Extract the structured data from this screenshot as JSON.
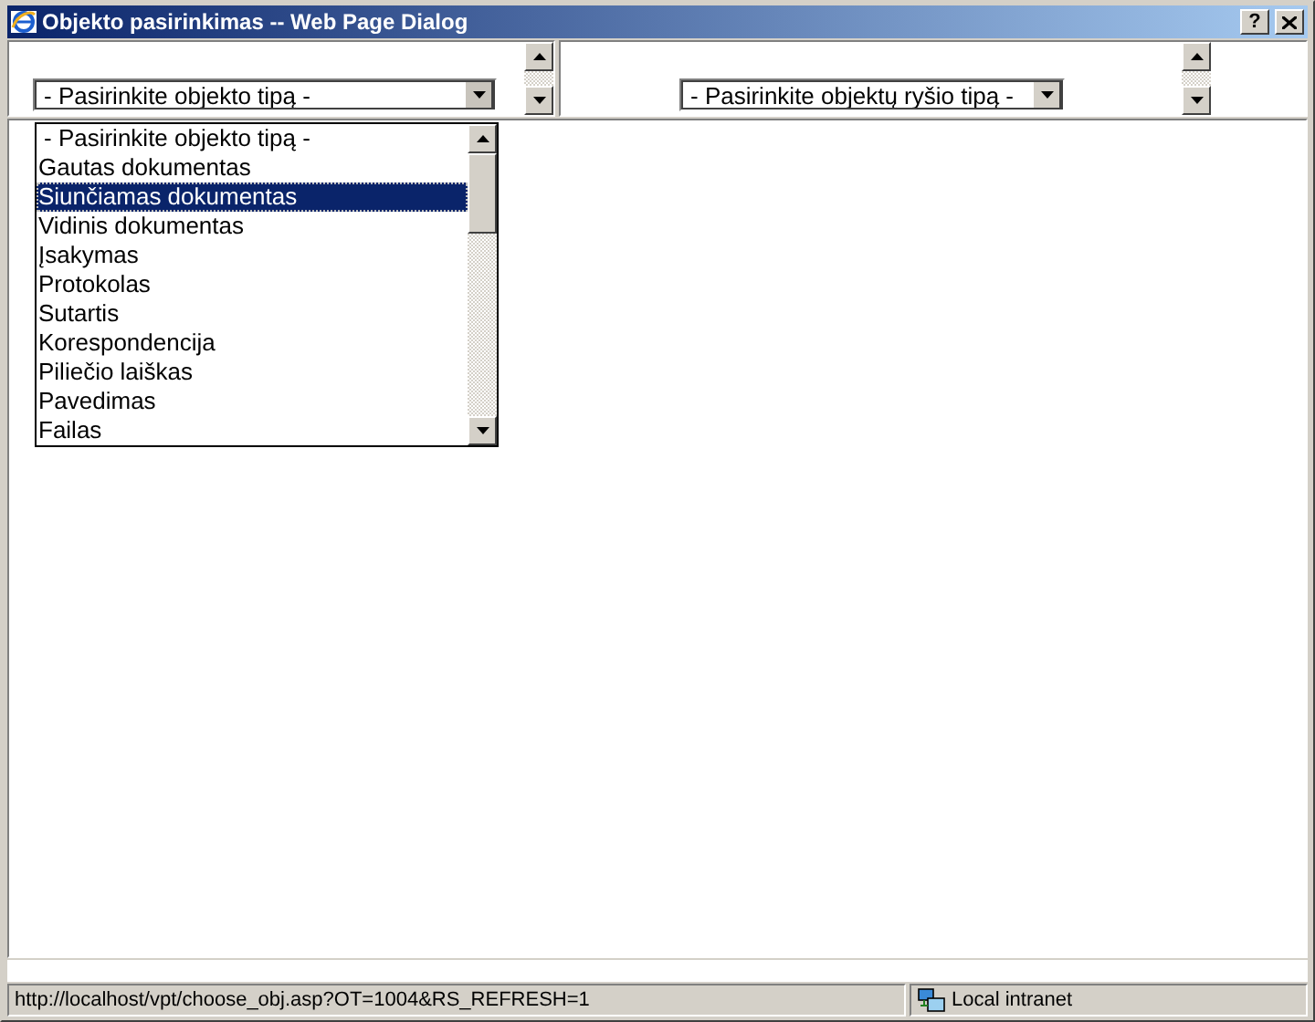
{
  "window": {
    "title": "Objekto pasirinkimas -- Web Page Dialog",
    "help_button": "?"
  },
  "left_frame": {
    "select": {
      "value": "- Pasirinkite objekto tipą -",
      "expanded": true
    }
  },
  "right_frame": {
    "select": {
      "value": "- Pasirinkite objektų ryšio tipą -",
      "expanded": false
    }
  },
  "dropdown_list": {
    "options": [
      {
        "label": "- Pasirinkite objekto tipą -",
        "selected": false
      },
      {
        "label": "Gautas dokumentas",
        "selected": false
      },
      {
        "label": "Siunčiamas dokumentas",
        "selected": true
      },
      {
        "label": "Vidinis dokumentas",
        "selected": false
      },
      {
        "label": "Įsakymas",
        "selected": false
      },
      {
        "label": "Protokolas",
        "selected": false
      },
      {
        "label": "Sutartis",
        "selected": false
      },
      {
        "label": "Korespondencija",
        "selected": false
      },
      {
        "label": "Piliečio laiškas",
        "selected": false
      },
      {
        "label": "Pavedimas",
        "selected": false
      },
      {
        "label": "Failas",
        "selected": false
      }
    ]
  },
  "status_bar": {
    "url": "http://localhost/vpt/choose_obj.asp?OT=1004&RS_REFRESH=1",
    "zone": "Local intranet"
  }
}
